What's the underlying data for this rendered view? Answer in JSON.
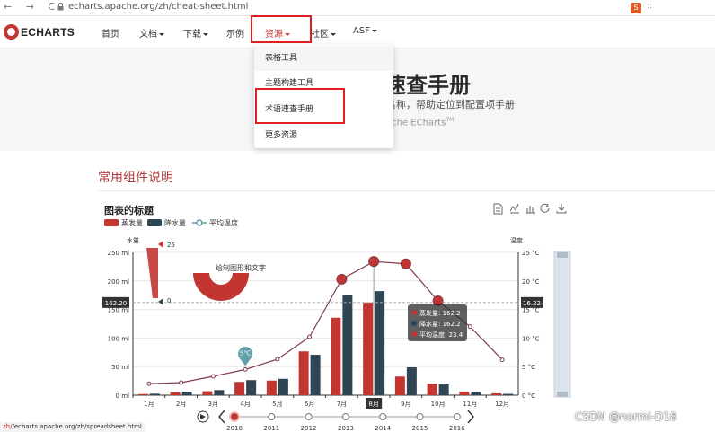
{
  "browser": {
    "nav_arrows": "← → C",
    "url": "echarts.apache.org/zh/cheat-sheet.html",
    "ext_label": "S",
    "ext2_label": "::"
  },
  "header": {
    "logo_text": "ECHARTS",
    "nav": [
      {
        "label": "首页",
        "caret": false
      },
      {
        "label": "文档",
        "caret": true
      },
      {
        "label": "下载",
        "caret": true
      },
      {
        "label": "示例",
        "caret": false
      },
      {
        "label": "资源",
        "caret": true,
        "active": true
      },
      {
        "label": "社区",
        "caret": true
      },
      {
        "label": "ASF",
        "caret": true
      }
    ]
  },
  "dropdown": {
    "items": [
      "表格工具",
      "主题构建工具",
      "术语速查手册",
      "更多资源"
    ]
  },
  "hero": {
    "title": "速查手册",
    "subtitle": "名称，帮助定位到配置项手册",
    "subtitle2": "ache ECharts",
    "tm": "TM"
  },
  "section": {
    "title": "常用组件说明"
  },
  "chart_data": {
    "type": "bar",
    "title": "图表的标题",
    "legend": [
      "蒸发量",
      "降水量",
      "平均温度"
    ],
    "categories": [
      "1月",
      "2月",
      "3月",
      "4月",
      "5月",
      "6月",
      "7月",
      "8月",
      "9月",
      "10月",
      "11月",
      "12月"
    ],
    "series": [
      {
        "name": "蒸发量",
        "type": "bar",
        "color": "#c23531",
        "values": [
          2.0,
          4.9,
          7.0,
          23.2,
          25.6,
          76.7,
          135.6,
          162.2,
          32.6,
          20.0,
          6.4,
          3.3
        ]
      },
      {
        "name": "降水量",
        "type": "bar",
        "color": "#2f4554",
        "values": [
          2.6,
          5.9,
          9.0,
          26.4,
          28.7,
          70.7,
          175.6,
          182.2,
          48.7,
          18.8,
          6.0,
          2.3
        ]
      },
      {
        "name": "平均温度",
        "type": "line",
        "color": "#61a0a8",
        "values": [
          2.0,
          2.2,
          3.3,
          4.5,
          6.3,
          10.2,
          20.3,
          23.4,
          23.0,
          16.5,
          12.0,
          6.2
        ]
      }
    ],
    "y_left": {
      "label": "水量",
      "ticks": [
        "0 ml",
        "50 ml",
        "100 ml",
        "150 ml",
        "200 ml",
        "250 ml"
      ],
      "ylim": [
        0,
        250
      ]
    },
    "y_right": {
      "label": "温度",
      "ticks": [
        "0 °C",
        "5 °C",
        "10 °C",
        "15 °C",
        "20 °C",
        "25 °C"
      ],
      "ylim": [
        0,
        25
      ]
    },
    "mark_left": "162.20",
    "mark_right": "16.22",
    "selected_category": "8月",
    "tooltip": [
      "蒸发量: 162.2",
      "降水量: 162.2",
      "平均温度: 23.4"
    ],
    "markpoint": "5℃",
    "visualmap": {
      "max": "25",
      "min": "0"
    },
    "graphic_text": "绘制图形和文字",
    "timeline": {
      "years": [
        "2010",
        "2011",
        "2012",
        "2013",
        "2014",
        "2015",
        "2016"
      ],
      "current": "2010"
    },
    "toolbox": [
      "data-view-icon",
      "line-switch-icon",
      "bar-switch-icon",
      "restore-icon",
      "save-image-icon"
    ]
  },
  "status": {
    "url_first": "zh/",
    "url_rest": "/echarts.apache.org/zh/spreadsheet.html"
  },
  "watermark": "CSDN @normi-D18"
}
